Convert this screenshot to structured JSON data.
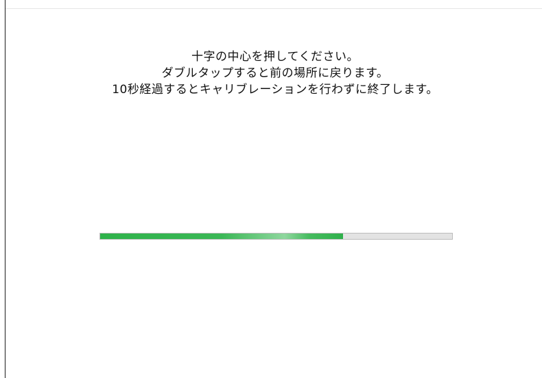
{
  "instructions": {
    "line1": "十字の中心を押してください。",
    "line2": "ダブルタップすると前の場所に戻ります。",
    "line3": "10秒経過するとキャリブレーションを行わずに終了します。"
  },
  "progress": {
    "value": 0.69
  },
  "colors": {
    "progress_fill": "#2eb24a",
    "progress_track": "#e3e3e3",
    "background": "#ffffff"
  }
}
